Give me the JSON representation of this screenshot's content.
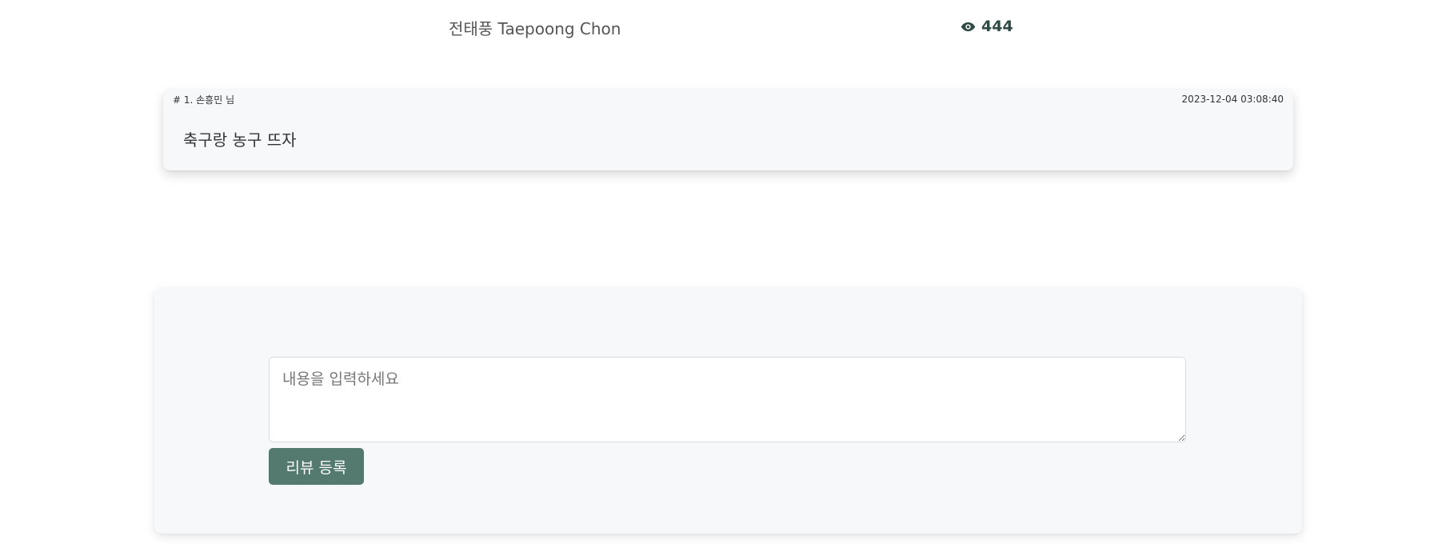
{
  "post": {
    "author": "전태풍 Taepoong Chon",
    "view_icon": "eye-icon",
    "view_count": "444"
  },
  "comments": [
    {
      "meta": "# 1. 손흥민 님",
      "date": "2023-12-04 03:08:40",
      "body": "축구랑 농구 뜨자"
    }
  ],
  "review_form": {
    "placeholder": "내용을 입력하세요",
    "value": "",
    "submit_label": "리뷰 등록"
  },
  "colors": {
    "accent": "#547a6f",
    "view_count": "#2f4a45",
    "card_background": "#f7f8f9"
  }
}
